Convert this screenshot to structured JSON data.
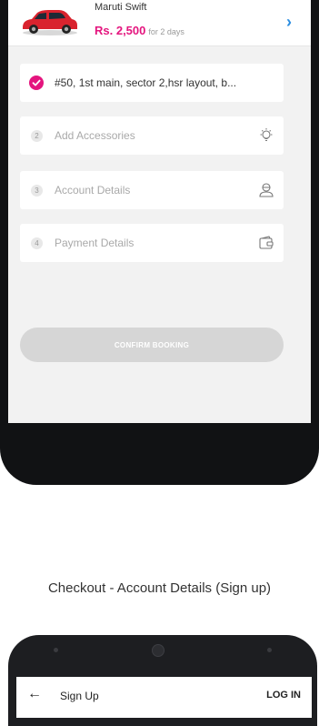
{
  "car": {
    "name": "Maruti Swift",
    "price": "Rs. 2,500",
    "duration": "for 2 days",
    "car_color": "#d9232e",
    "accent": "#e4157e",
    "link_color": "#2a8de0"
  },
  "steps": [
    {
      "num": "",
      "label": "#50, 1st main, sector 2,hsr layout, b...",
      "state": "done",
      "icon": "check-icon"
    },
    {
      "num": "2",
      "label": "Add Accessories",
      "state": "pending",
      "icon": "lightbulb-icon"
    },
    {
      "num": "3",
      "label": "Account Details",
      "state": "pending",
      "icon": "user-icon"
    },
    {
      "num": "4",
      "label": "Payment Details",
      "state": "pending",
      "icon": "wallet-icon"
    }
  ],
  "confirm_label": "CONFIRM BOOKING",
  "caption": "Checkout - Account Details (Sign up)",
  "signup": {
    "title": "Sign Up",
    "login_label": "LOG IN",
    "back_icon": "back-arrow-icon"
  }
}
